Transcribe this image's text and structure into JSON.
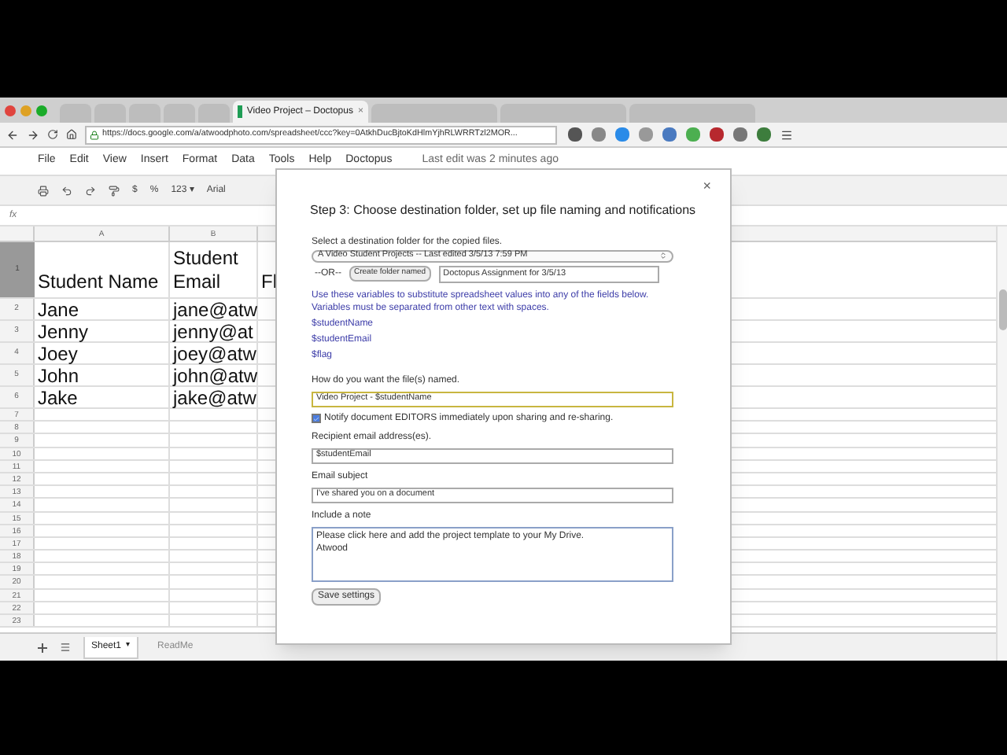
{
  "browser": {
    "tabs": [
      {
        "selected": false
      },
      {
        "selected": false
      },
      {
        "selected": false
      },
      {
        "selected": false
      },
      {
        "selected": false
      },
      {
        "selected": true,
        "title": "Video Project – Doctopus",
        "close": "×"
      },
      {
        "selected": false
      },
      {
        "selected": false
      },
      {
        "selected": false
      }
    ],
    "url": "https://docs.google.com/a/atwoodphoto.com/spreadsheet/ccc?key=0AtkhDucBjtoKdHlmYjhRLWRRTzl2MOR..."
  },
  "menu": {
    "items": [
      "File",
      "Edit",
      "View",
      "Insert",
      "Format",
      "Data",
      "Tools",
      "Help",
      "Doctopus"
    ],
    "status": "Last edit was 2 minutes ago"
  },
  "toolbar": {
    "items": [
      "$",
      "%",
      "123 ▾",
      "Arial"
    ]
  },
  "formula_bar": {
    "label": "fx"
  },
  "sheet": {
    "columns": [
      "A",
      "B"
    ],
    "header_row": {
      "number": "1",
      "cells": [
        "Student Name",
        "Student Email",
        "Fl"
      ]
    },
    "rows": [
      {
        "number": "2",
        "cells": [
          "Jane",
          "jane@atw"
        ]
      },
      {
        "number": "3",
        "cells": [
          "Jenny",
          "jenny@at"
        ]
      },
      {
        "number": "4",
        "cells": [
          "Joey",
          "joey@atw"
        ]
      },
      {
        "number": "5",
        "cells": [
          "John",
          "john@atw"
        ]
      },
      {
        "number": "6",
        "cells": [
          "Jake",
          "jake@atw"
        ]
      }
    ],
    "empty_rows": [
      "7",
      "8",
      "9",
      "10",
      "11",
      "12",
      "13",
      "14",
      "15",
      "16",
      "17",
      "18",
      "19",
      "20",
      "21",
      "22",
      "23"
    ],
    "tabs": [
      {
        "label": "Sheet1",
        "selected": true,
        "caret": "▾"
      },
      {
        "label": "ReadMe",
        "selected": false
      }
    ]
  },
  "dialog": {
    "close": "×",
    "title": "Step 3: Choose destination folder, set up file naming and notifications",
    "folder_label": "Select a destination folder for the copied files.",
    "folder_select": "A Video Student Projects -- Last edited 3/5/13 7:59 PM",
    "or_label": "--OR--",
    "create_button": "Create folder named",
    "folder_name": "Doctopus Assignment for 3/5/13",
    "variables_hint": "Use these variables to substitute spreadsheet values into any of the fields below. Variables must be separated from other text with spaces.",
    "variables": [
      "$studentName",
      "$studentEmail",
      "$flag"
    ],
    "naming_label": "How do you want the file(s) named.",
    "naming_value": "Video Project - $studentName",
    "notify": {
      "label": "Notify document EDITORS immediately upon sharing and re-sharing.",
      "checked": true
    },
    "recipient_label": "Recipient email address(es).",
    "recipient_value": "$studentEmail",
    "subject_label": "Email subject",
    "subject_value": "I've shared you on a document",
    "note_label": "Include a note",
    "note_value": "Please click here and add the project template to your My Drive.\nAtwood",
    "save_button": "Save settings"
  }
}
